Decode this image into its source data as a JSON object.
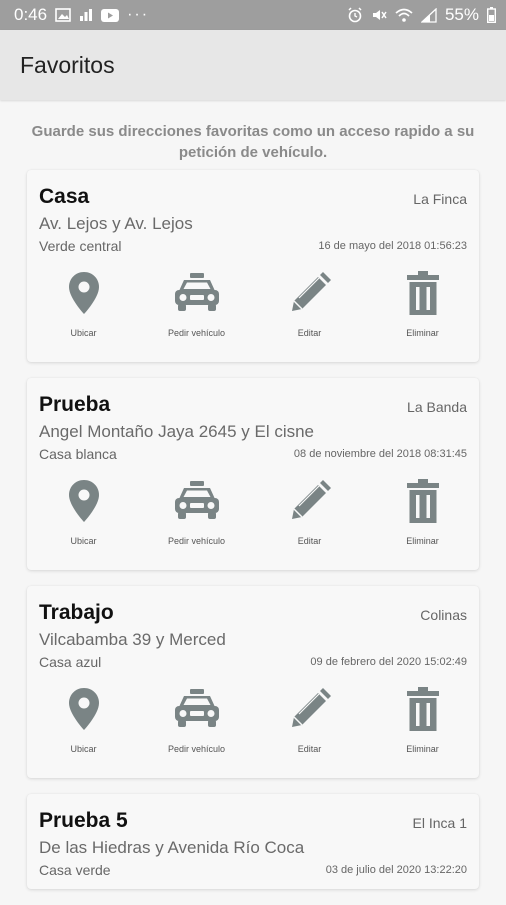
{
  "status_bar": {
    "time": "0:46",
    "dots": "···",
    "battery_percent": "55%"
  },
  "appbar": {
    "title": "Favoritos"
  },
  "intro_text": "Guarde sus direcciones favoritas como un acceso rapido a su petición de vehículo.",
  "actions": {
    "locate": "Ubicar",
    "request": "Pedir vehículo",
    "edit": "Editar",
    "delete": "Eliminar"
  },
  "icons": {
    "locate": "map-pin-icon",
    "request": "taxi-icon",
    "edit": "pencil-icon",
    "delete": "trash-icon"
  },
  "colors": {
    "icon": "#7a8485",
    "status_bar": "#9e9e9e",
    "app_bar": "#e7e7e7"
  },
  "favorites": [
    {
      "name": "Casa",
      "zone": "La Finca",
      "address": "Av. Lejos y Av. Lejos",
      "reference": "Verde central",
      "date": "16 de mayo del 2018 01:56:23"
    },
    {
      "name": "Prueba",
      "zone": "La Banda",
      "address": "Angel Montaño Jaya 2645 y El cisne",
      "reference": "Casa blanca",
      "date": "08 de noviembre del 2018 08:31:45"
    },
    {
      "name": "Trabajo",
      "zone": "Colinas",
      "address": "Vilcabamba 39 y Merced",
      "reference": "Casa azul",
      "date": "09 de febrero del 2020 15:02:49"
    },
    {
      "name": "Prueba 5",
      "zone": "El Inca 1",
      "address": "De las Hiedras y Avenida Río Coca",
      "reference": "Casa verde",
      "date": "03 de julio del 2020 13:22:20"
    }
  ]
}
